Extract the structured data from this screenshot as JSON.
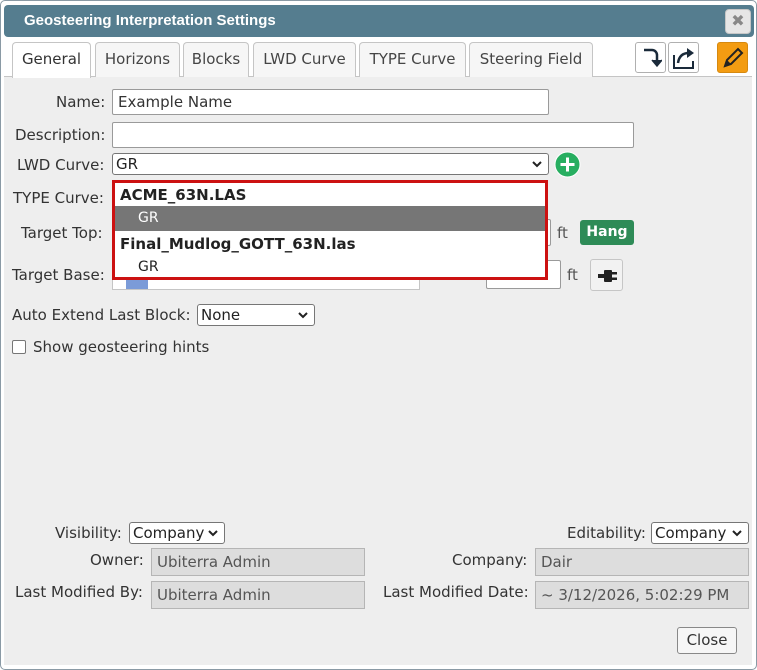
{
  "dialog": {
    "title": "Geosteering Interpretation Settings",
    "close_icon": "close-icon",
    "close_glyph": "✖"
  },
  "tabs": [
    {
      "label": "General",
      "active": true
    },
    {
      "label": "Horizons"
    },
    {
      "label": "Blocks"
    },
    {
      "label": "LWD Curve"
    },
    {
      "label": "TYPE Curve"
    },
    {
      "label": "Steering Field"
    }
  ],
  "toolbar": {
    "import_icon": "import-icon",
    "export_icon": "share-export-icon",
    "edit_icon": "pencil-edit-icon"
  },
  "form": {
    "name_label": "Name:",
    "name_value": "Example Name",
    "description_label": "Description:",
    "description_value": "",
    "lwd_label": "LWD Curve:",
    "lwd_value": "GR",
    "type_label": "TYPE Curve:",
    "target_top_label": "Target Top:",
    "target_top_unit": "ft",
    "hang_label": "Hang",
    "target_base_label": "Target Base:",
    "target_base_unit": "ft",
    "auto_extend_label": "Auto Extend Last Block:",
    "auto_extend_value": "None",
    "hints_label": "Show geosteering hints",
    "hints_checked": false
  },
  "type_dropdown": {
    "groups": [
      {
        "label": "ACME_63N.LAS",
        "options": [
          {
            "label": "GR",
            "selected": true
          }
        ]
      },
      {
        "label": "Final_Mudlog_GOTT_63N.las",
        "options": [
          {
            "label": "GR",
            "selected": false
          }
        ]
      }
    ]
  },
  "footer": {
    "visibility_label": "Visibility:",
    "visibility_value": "Company",
    "editability_label": "Editability:",
    "editability_value": "Company",
    "owner_label": "Owner:",
    "owner_value": "Ubiterra Admin",
    "company_label": "Company:",
    "company_value": "Dair",
    "last_modified_by_label": "Last Modified By:",
    "last_modified_by_value": "Ubiterra Admin",
    "last_modified_date_label": "Last Modified Date:",
    "last_modified_date_value": "~ 3/12/2026, 5:02:29 PM",
    "close_label": "Close"
  },
  "colors": {
    "titlebar": "#557d8f",
    "hang_button": "#2e8b57",
    "add_button": "#27ae60",
    "edit_button": "#f39c12",
    "dropdown_border": "#cc1111",
    "selected_option": "#767676"
  }
}
